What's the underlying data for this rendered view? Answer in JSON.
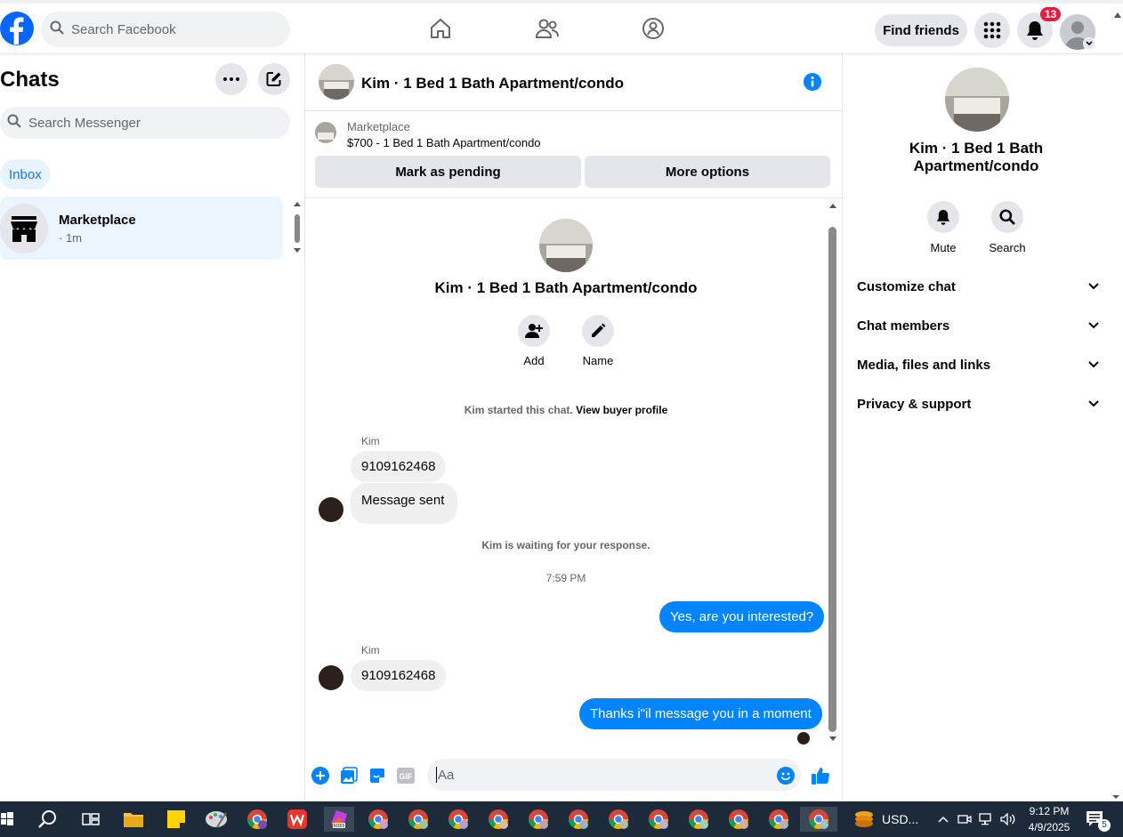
{
  "topbar": {
    "search_placeholder": "Search Facebook",
    "find_friends": "Find friends",
    "notification_count": "13"
  },
  "chats": {
    "title": "Chats",
    "search_placeholder": "Search Messenger",
    "inbox_label": "Inbox",
    "items": [
      {
        "name": "Marketplace",
        "meta": "· 1m"
      }
    ]
  },
  "conversation": {
    "header_title": "Kim · 1 Bed 1 Bath Apartment/condo",
    "marketplace_label": "Marketplace",
    "listing": "$700 - 1 Bed 1 Bath Apartment/condo",
    "mark_pending": "Mark as pending",
    "more_options": "More options",
    "center_title": "Kim · 1 Bed 1 Bath Apartment/condo",
    "add_label": "Add",
    "name_label": "Name",
    "started_text": "Kim started this chat.",
    "view_profile": "View buyer profile",
    "waiting_text": "Kim is waiting for your response.",
    "timestamp": "7:59 PM",
    "messages": [
      {
        "sender": "Kim",
        "text": "9109162468",
        "direction": "in"
      },
      {
        "sender": "",
        "text": "Message sent",
        "direction": "in"
      },
      {
        "sender": "",
        "text": "Yes, are you interested?",
        "direction": "out"
      },
      {
        "sender": "Kim",
        "text": "9109162468",
        "direction": "in"
      },
      {
        "sender": "",
        "text": "Thanks i\"il message you in a moment",
        "direction": "out"
      }
    ],
    "composer_placeholder": "Aa"
  },
  "info": {
    "title_line1": "Kim · 1 Bed 1 Bath",
    "title_line2": "Apartment/condo",
    "mute_label": "Mute",
    "search_label": "Search",
    "sections": [
      "Customize chat",
      "Chat members",
      "Media, files and links",
      "Privacy & support"
    ]
  },
  "taskbar": {
    "currency": "USD...",
    "time": "9:12 PM",
    "date": "4/9/2025",
    "notif_count": "5"
  },
  "colors": {
    "accent": "#0084ff",
    "fb_blue": "#0866ff",
    "badge_red": "#e41e3f"
  }
}
